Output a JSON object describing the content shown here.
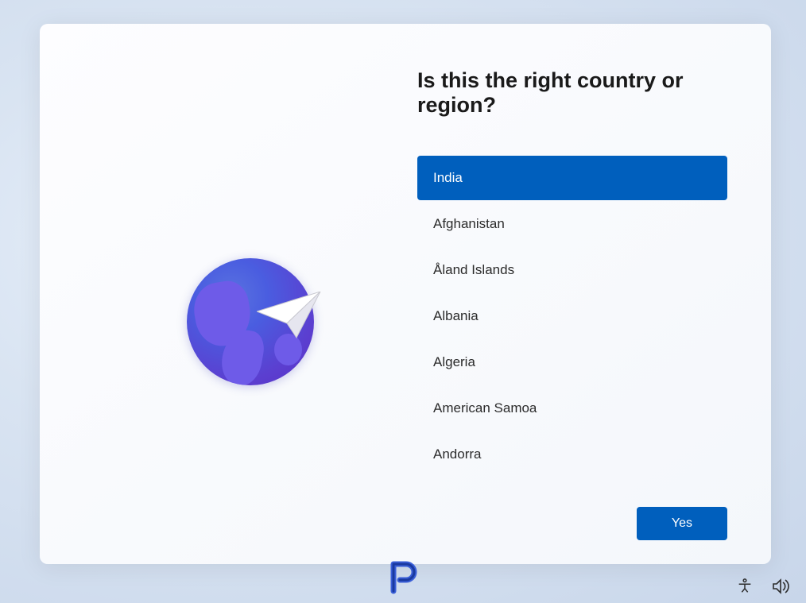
{
  "heading": "Is this the right country or region?",
  "countries": [
    {
      "name": "India",
      "selected": true
    },
    {
      "name": "Afghanistan",
      "selected": false
    },
    {
      "name": "Åland Islands",
      "selected": false
    },
    {
      "name": "Albania",
      "selected": false
    },
    {
      "name": "Algeria",
      "selected": false
    },
    {
      "name": "American Samoa",
      "selected": false
    },
    {
      "name": "Andorra",
      "selected": false
    }
  ],
  "confirm_button": "Yes",
  "colors": {
    "accent": "#005fbd",
    "globe_gradient_a": "#5a73e0",
    "globe_gradient_b": "#5930c5"
  },
  "icons": {
    "globe": "globe-plane-icon",
    "accessibility": "accessibility-icon",
    "volume": "volume-icon",
    "watermark": "watermark-p-icon"
  }
}
